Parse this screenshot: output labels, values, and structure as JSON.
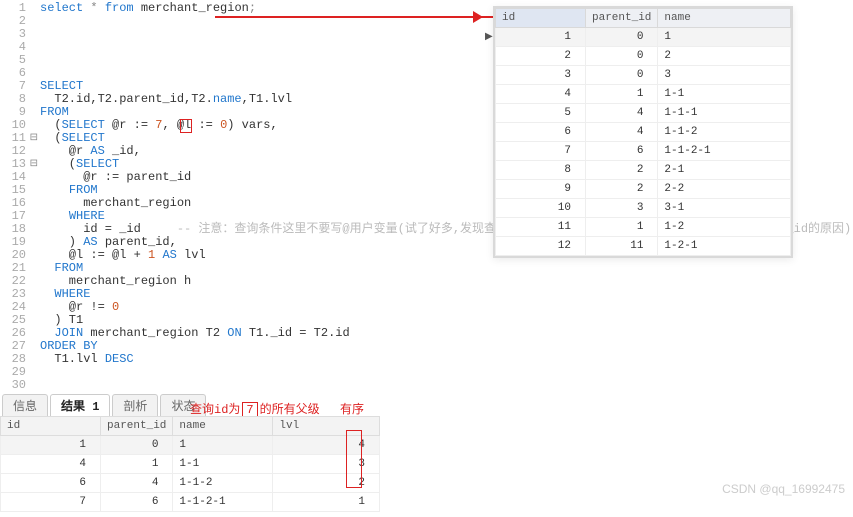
{
  "code_lines": [
    {
      "n": 1,
      "html": "<span class='kw'>select</span> <span class='op'>*</span> <span class='kw'>from</span> merchant_region<span class='op'>;</span>",
      "fold": ""
    },
    {
      "n": 2,
      "html": "",
      "fold": ""
    },
    {
      "n": 3,
      "html": "",
      "fold": ""
    },
    {
      "n": 4,
      "html": "",
      "fold": ""
    },
    {
      "n": 5,
      "html": "",
      "fold": ""
    },
    {
      "n": 6,
      "html": "",
      "fold": ""
    },
    {
      "n": 7,
      "html": "<span class='kw'>SELECT</span>",
      "fold": ""
    },
    {
      "n": 8,
      "html": "  T2.id,T2.parent_id,T2.<span class='fn'>name</span>,T1.lvl",
      "fold": ""
    },
    {
      "n": 9,
      "html": "<span class='kw'>FROM</span>",
      "fold": ""
    },
    {
      "n": 10,
      "html": "  (<span class='kw'>SELECT</span> @r := <span class='num'>7</span>, @l := <span class='num'>0</span>) vars,",
      "fold": ""
    },
    {
      "n": 11,
      "html": "  (<span class='kw'>SELECT</span>",
      "fold": "⊟"
    },
    {
      "n": 12,
      "html": "    @r <span class='kw'>AS</span> _id,",
      "fold": ""
    },
    {
      "n": 13,
      "html": "    (<span class='kw'>SELECT</span>",
      "fold": "⊟"
    },
    {
      "n": 14,
      "html": "      @r := parent_id",
      "fold": ""
    },
    {
      "n": 15,
      "html": "    <span class='kw'>FROM</span>",
      "fold": ""
    },
    {
      "n": 16,
      "html": "      merchant_region",
      "fold": ""
    },
    {
      "n": 17,
      "html": "    <span class='kw'>WHERE</span>",
      "fold": ""
    },
    {
      "n": 18,
      "html": "      id = _id     <span class='cm'>-- 注意：查询条件这里不要写@用户变量(试了好多,发现查询结果没什么固定的规律,这也可能是前面要写@r as _id的原因)</span>",
      "fold": ""
    },
    {
      "n": 19,
      "html": "    ) <span class='kw'>AS</span> parent_id,",
      "fold": ""
    },
    {
      "n": 20,
      "html": "    @l := @l + <span class='num'>1</span> <span class='kw'>AS</span> lvl",
      "fold": ""
    },
    {
      "n": 21,
      "html": "  <span class='kw'>FROM</span>",
      "fold": ""
    },
    {
      "n": 22,
      "html": "    merchant_region h",
      "fold": ""
    },
    {
      "n": 23,
      "html": "  <span class='kw'>WHERE</span>",
      "fold": ""
    },
    {
      "n": 24,
      "html": "    @r != <span class='num'>0</span>",
      "fold": ""
    },
    {
      "n": 25,
      "html": "  ) T1",
      "fold": ""
    },
    {
      "n": 26,
      "html": "  <span class='kw'>JOIN</span> merchant_region T2 <span class='kw'>ON</span> T1._id = T2.id",
      "fold": ""
    },
    {
      "n": 27,
      "html": "<span class='kw'>ORDER BY</span>",
      "fold": ""
    },
    {
      "n": 28,
      "html": "  T1.lvl <span class='kw'>DESC</span>",
      "fold": ""
    },
    {
      "n": 29,
      "html": "",
      "fold": ""
    },
    {
      "n": 30,
      "html": "",
      "fold": ""
    }
  ],
  "popup_headers": {
    "h1": "id",
    "h2": "parent_id",
    "h3": "name"
  },
  "popup_rows": [
    {
      "id": "1",
      "pid": "0",
      "name": "1"
    },
    {
      "id": "2",
      "pid": "0",
      "name": "2"
    },
    {
      "id": "3",
      "pid": "0",
      "name": "3"
    },
    {
      "id": "4",
      "pid": "1",
      "name": "1-1"
    },
    {
      "id": "5",
      "pid": "4",
      "name": "1-1-1"
    },
    {
      "id": "6",
      "pid": "4",
      "name": "1-1-2"
    },
    {
      "id": "7",
      "pid": "6",
      "name": "1-1-2-1"
    },
    {
      "id": "8",
      "pid": "2",
      "name": "2-1"
    },
    {
      "id": "9",
      "pid": "2",
      "name": "2-2"
    },
    {
      "id": "10",
      "pid": "3",
      "name": "3-1"
    },
    {
      "id": "11",
      "pid": "1",
      "name": "1-2"
    },
    {
      "id": "12",
      "pid": "11",
      "name": "1-2-1"
    }
  ],
  "tabs": {
    "info": "信息",
    "result": "结果 1",
    "profile": "剖析",
    "status": "状态"
  },
  "note1_pre": "查询id为",
  "note1_box": "7",
  "note1_post": "的所有父级",
  "note2": "有序",
  "result_headers": {
    "h1": "id",
    "h2": "parent_id",
    "h3": "name",
    "h4": "lvl"
  },
  "result_rows": [
    {
      "id": "1",
      "pid": "0",
      "name": "1",
      "lvl": "4"
    },
    {
      "id": "4",
      "pid": "1",
      "name": "1-1",
      "lvl": "3"
    },
    {
      "id": "6",
      "pid": "4",
      "name": "1-1-2",
      "lvl": "2"
    },
    {
      "id": "7",
      "pid": "6",
      "name": "1-1-2-1",
      "lvl": "1"
    }
  ],
  "watermark": "CSDN @qq_16992475",
  "param_box": "7"
}
